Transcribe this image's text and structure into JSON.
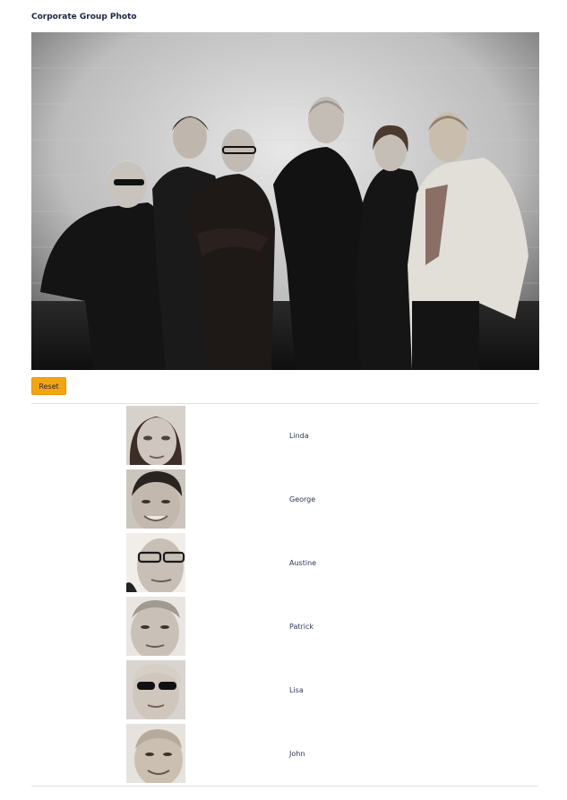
{
  "page": {
    "title": "Corporate Group Photo"
  },
  "photo": {
    "alt": "Corporate group photo of six people"
  },
  "controls": {
    "reset_label": "Reset"
  },
  "people": [
    {
      "name": "Linda"
    },
    {
      "name": "George"
    },
    {
      "name": "Austine"
    },
    {
      "name": "Patrick"
    },
    {
      "name": "Lisa"
    },
    {
      "name": "John"
    }
  ],
  "colors": {
    "accent": "#f2a514",
    "text": "#1b2540",
    "divider": "#dcdfe4"
  }
}
